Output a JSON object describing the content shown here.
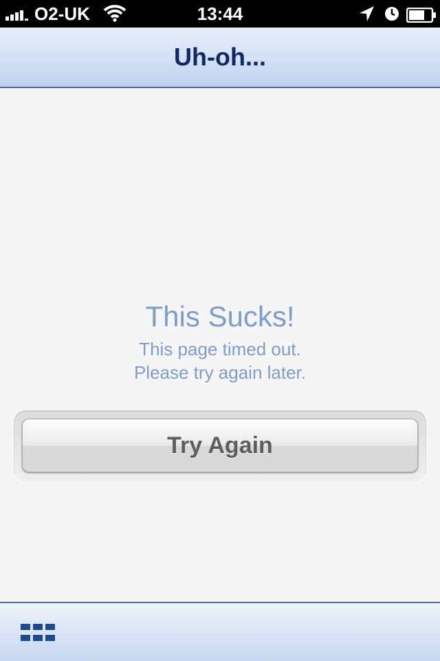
{
  "status_bar": {
    "carrier": "O2-UK",
    "time": "13:44",
    "signal_bars": 4,
    "battery_percent": 70,
    "icons": [
      "signal-icon",
      "wifi-icon",
      "location-arrow-icon",
      "alarm-clock-icon",
      "battery-icon"
    ]
  },
  "nav": {
    "title": "Uh-oh..."
  },
  "error": {
    "headline": "This Sucks!",
    "line1": "This page timed out.",
    "line2": "Please try again later."
  },
  "actions": {
    "try_again_label": "Try Again"
  },
  "toolbar": {
    "icon": "grid-menu-icon"
  },
  "colors": {
    "nav_title": "#0d2a66",
    "message_text": "#7f9ccb",
    "bar_border": "#4a6ba3",
    "background": "#f5f5f5"
  }
}
